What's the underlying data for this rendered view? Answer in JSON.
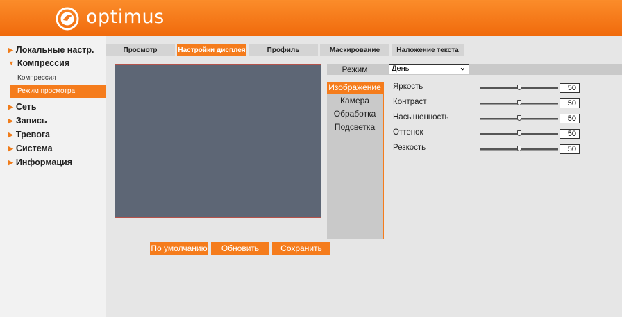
{
  "app": {
    "brand": "optimus",
    "brand_color": "#f57c1c",
    "logo_icon": "optimus-logo-icon"
  },
  "sidebar": {
    "items": [
      {
        "label": "Локальные настр.",
        "expanded": false
      },
      {
        "label": "Компрессия",
        "expanded": true,
        "children": [
          {
            "label": "Компрессия",
            "active": false
          },
          {
            "label": "Режим просмотра",
            "active": true
          }
        ]
      },
      {
        "label": "Сеть",
        "expanded": false
      },
      {
        "label": "Запись",
        "expanded": false
      },
      {
        "label": "Тревога",
        "expanded": false
      },
      {
        "label": "Система",
        "expanded": false
      },
      {
        "label": "Информация",
        "expanded": false
      }
    ]
  },
  "tabs": [
    {
      "label": "Просмотр",
      "active": false
    },
    {
      "label": "Настройки дисплея",
      "active": true
    },
    {
      "label": "Профиль",
      "active": false
    },
    {
      "label": "Маскирование",
      "active": false
    },
    {
      "label": "Наложение текста",
      "active": false
    }
  ],
  "mode": {
    "label": "Режим",
    "selected": "День"
  },
  "subtabs": [
    {
      "label": "Изображение",
      "active": true
    },
    {
      "label": "Камера",
      "active": false
    },
    {
      "label": "Обработка",
      "active": false
    },
    {
      "label": "Подсветка",
      "active": false
    }
  ],
  "params": [
    {
      "label": "Яркость",
      "value": "50",
      "level": 0.5
    },
    {
      "label": "Контраст",
      "value": "50",
      "level": 0.5
    },
    {
      "label": "Насыщенность",
      "value": "50",
      "level": 0.5
    },
    {
      "label": "Оттенок",
      "value": "50",
      "level": 0.5
    },
    {
      "label": "Резкость",
      "value": "50",
      "level": 0.5
    }
  ],
  "buttons": {
    "default": "По умолчанию",
    "refresh": "Обновить",
    "save": "Сохранить"
  }
}
